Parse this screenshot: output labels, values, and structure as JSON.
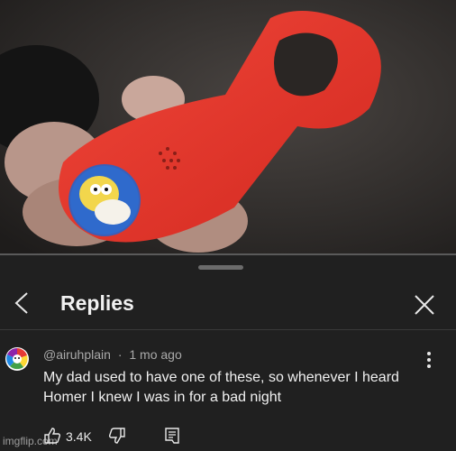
{
  "header": {
    "title": "Replies"
  },
  "comment": {
    "author": "@airuhplain",
    "separator": "·",
    "time": "1 mo ago",
    "text": "My dad used to have one of these, so whenever I heard Homer I knew I was in for a bad night",
    "like_count": "3.4K"
  },
  "watermark": "imgflip.com",
  "icons": {
    "back": "chevron-left-icon",
    "close": "close-icon",
    "more": "vertical-dots-icon",
    "like": "thumbs-up-icon",
    "dislike": "thumbs-down-icon",
    "reply": "reply-icon"
  },
  "colors": {
    "panel_background": "#202020",
    "text_primary": "#f1f1f1",
    "text_secondary": "#aaaaaa",
    "opener_red": "#e8392f"
  }
}
